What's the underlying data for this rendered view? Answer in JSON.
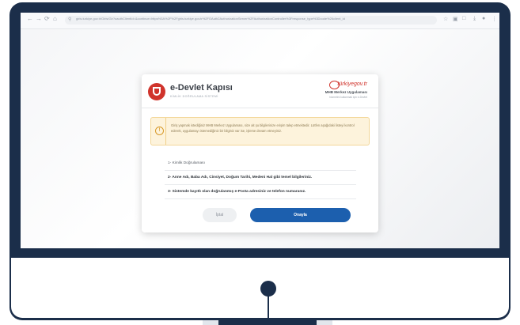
{
  "browser": {
    "url": "giris.turkiye.gov.tr/Giris/Gir?oauthClientId=&continue=https%3A%2F%2Fgiris.turkiye.gov.tr%2FOAuth2AuthorizationServer%2FAuthorizationController%3Fresponse_type%3Dcode%26client_id",
    "nav_back": "←",
    "nav_forward": "→",
    "nav_reload": "⟳",
    "nav_home": "⌂"
  },
  "dialog": {
    "brand_title": "e-Devlet Kapısı",
    "brand_subtitle": "KİMLİK DOĞRULAMA SİSTEMİ",
    "partner_logo": "türkiyegov.tr",
    "app_name": "MHB Merkez Uygulaması",
    "app_note": "hizmetini kullanmak için e-Devlet",
    "alert_text": "Giriş yapmak istediğiniz MHB Merkez Uygulaması, size ait şu bilgilerinize erişim talep etmektedir. Lütfen aşağıdaki listeyi kontrol ederek, uygulamayı istemediğiniz bir bilginiz var ise, işleme devam etmeyiniz.",
    "items": [
      "1- Kimlik Doğrulaması",
      "2- Anne Adı, Baba Adı, Cinsiyet, Doğum Tarihi, Medeni Hal gibi temel bilgileriniz.",
      "3- Sistemde kayıtlı olan doğrulanmış e-Posta adresiniz ve telefon numaranız."
    ],
    "cancel_label": "İptal",
    "confirm_label": "Onayla"
  },
  "colors": {
    "monitor_frame": "#1b2e4a",
    "primary_button": "#1c5fae",
    "alert_background": "#fdf3dc",
    "logo_red": "#d0342c"
  }
}
